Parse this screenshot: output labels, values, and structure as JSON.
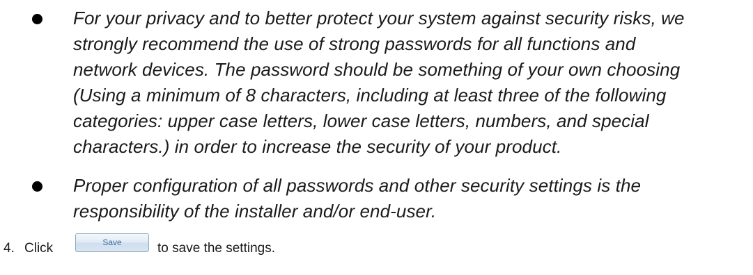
{
  "bullets": [
    {
      "lines": [
        "For your privacy and to better protect your system against security risks, we",
        "strongly recommend the use of strong passwords for all functions and",
        "network devices. The password should be something of your own choosing",
        "(Using a minimum of 8 characters, including at least three of the following",
        "categories: upper case letters, lower case letters, numbers, and special",
        "characters.) in order to increase the security of your product."
      ]
    },
    {
      "lines": [
        "Proper configuration of all passwords and other security settings is the",
        "responsibility of the installer and/or end-user."
      ]
    }
  ],
  "step": {
    "number": "4.",
    "before_button": "Click",
    "button_label": "Save",
    "after_button": "to save the settings."
  }
}
